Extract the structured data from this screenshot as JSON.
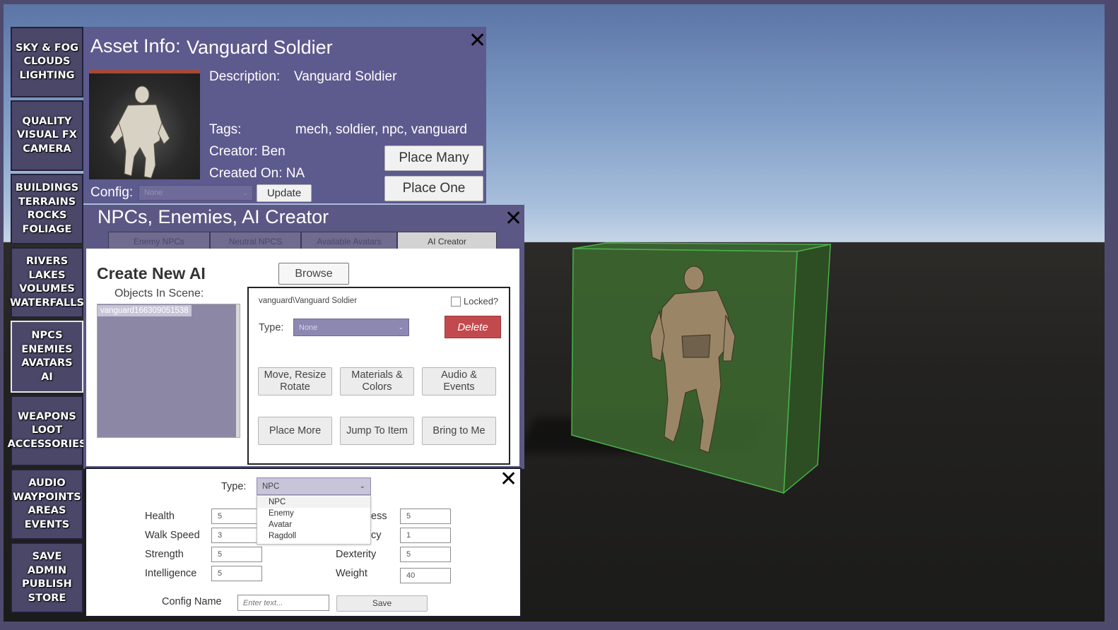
{
  "sidebar": {
    "items": [
      {
        "label": "SKY & FOG\nCLOUDS\nLIGHTING"
      },
      {
        "label": "QUALITY\nVISUAL FX\nCAMERA"
      },
      {
        "label": "BUILDINGS\nTERRAINS\nROCKS\nFOLIAGE"
      },
      {
        "label": "RIVERS\nLAKES\nVOLUMES\nWATERFALLS"
      },
      {
        "label": "NPCS\nENEMIES\nAVATARS\nAI"
      },
      {
        "label": "WEAPONS\nLOOT\nACCESSORIES"
      },
      {
        "label": "AUDIO\nWAYPOINTS\nAREAS\nEVENTS"
      },
      {
        "label": "SAVE\nADMIN\nPUBLISH\nSTORE"
      }
    ]
  },
  "asset_info": {
    "title_prefix": "Asset Info:",
    "title_name": "Vanguard Soldier",
    "description_label": "Description:",
    "description_value": "Vanguard Soldier",
    "tags_label": "Tags:",
    "tags_value": "mech, soldier, npc, vanguard",
    "creator": "Creator: Ben",
    "created_on": "Created On: NA",
    "config_label": "Config:",
    "config_value": "None",
    "update_label": "Update",
    "place_many_label": "Place Many",
    "place_one_label": "Place One"
  },
  "npc_panel": {
    "title": "NPCs, Enemies, AI Creator",
    "tabs": [
      "Enemy NPCs",
      "Neutral NPCS",
      "Available Avatars",
      "AI Creator"
    ],
    "create_title": "Create New AI",
    "browse_label": "Browse",
    "objects_label": "Objects In Scene:",
    "objects": [
      "vanguard1663090​51538"
    ],
    "item_name": "vanguard\\Vanguard Soldier",
    "locked_label": "Locked?",
    "type_label": "Type:",
    "type_value": "None",
    "delete_label": "Delete",
    "actions": [
      "Move, Resize\nRotate",
      "Materials &\nColors",
      "Audio &\nEvents",
      "Place More",
      "Jump To Item",
      "Bring to Me"
    ]
  },
  "stats": {
    "type_label": "Type:",
    "type_value": "NPC",
    "type_options": [
      "NPC",
      "Enemy",
      "Avatar",
      "Ragdoll"
    ],
    "left": [
      {
        "label": "Health",
        "value": "5"
      },
      {
        "label": "Walk Speed",
        "value": "3"
      },
      {
        "label": "Strength",
        "value": "5"
      },
      {
        "label": "Intelligence",
        "value": "5"
      }
    ],
    "right": [
      {
        "label": "ess",
        "value": "5"
      },
      {
        "label": "cy",
        "value": "1"
      },
      {
        "label": "Dexterity",
        "value": "5"
      },
      {
        "label": "Weight",
        "value": "40"
      }
    ],
    "config_name_label": "Config Name",
    "config_name_placeholder": "Enter text...",
    "save_label": "Save"
  },
  "colors": {
    "panel": "#5d5a8e",
    "delete": "#c24a4e",
    "select": "#8c88b2",
    "bounding_box": "#3f6a2e"
  }
}
